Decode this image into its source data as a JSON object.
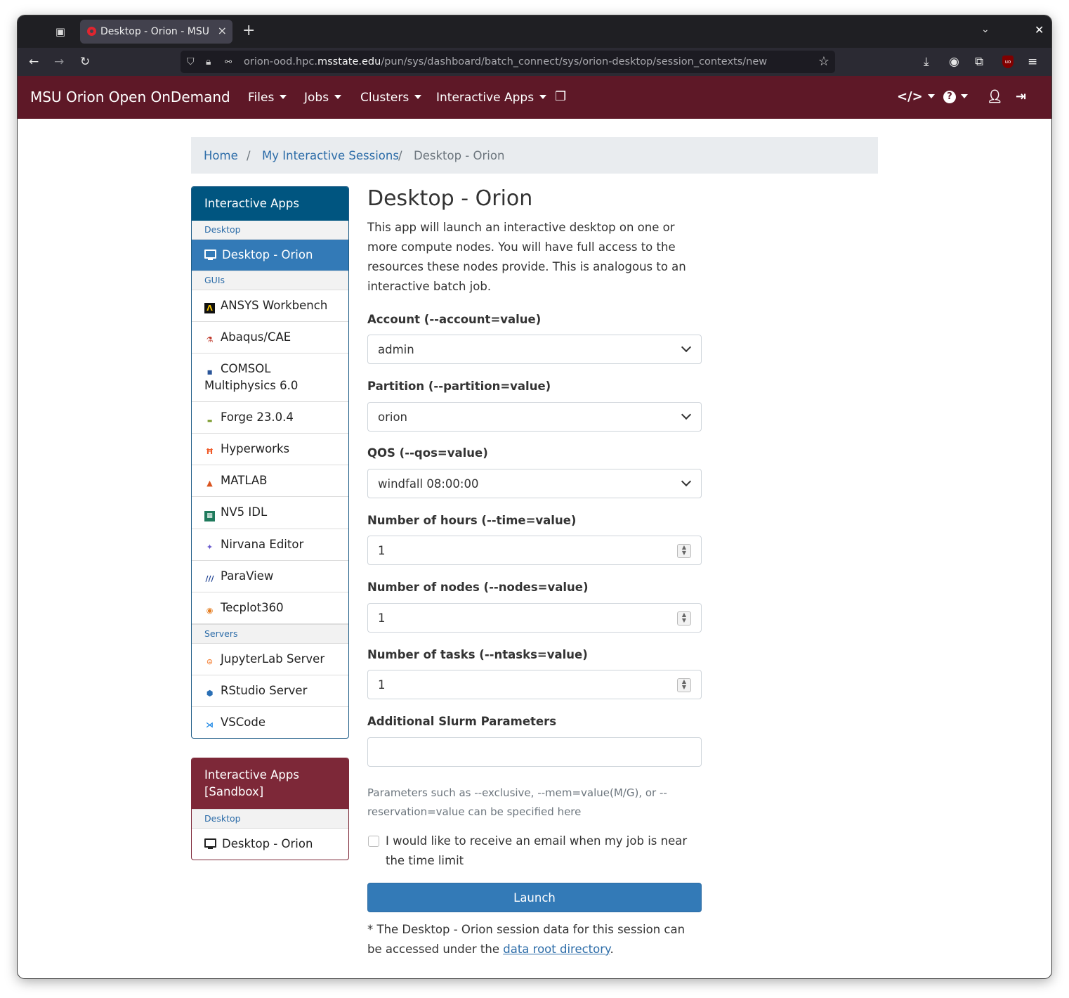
{
  "browser": {
    "tab_title": "Desktop - Orion - MSU Orion Open OnDemand",
    "tab_close": "×",
    "new_tab": "+",
    "url_prefix": "orion-ood.hpc.",
    "url_host": "msstate.edu",
    "url_path": "/pun/sys/dashboard/batch_connect/sys/orion-desktop/session_contexts/new"
  },
  "appnav": {
    "brand": "MSU Orion Open OnDemand",
    "menus": [
      "Files",
      "Jobs",
      "Clusters",
      "Interactive Apps"
    ]
  },
  "breadcrumb": {
    "home": "Home",
    "sep": "/",
    "sessions": "My Interactive Sessions",
    "current": "Desktop - Orion"
  },
  "sidebar": {
    "title": "Interactive Apps",
    "cat_desktop": "Desktop",
    "desktop_orion": "Desktop - Orion",
    "cat_guis": "GUIs",
    "guis": [
      "ANSYS Workbench",
      "Abaqus/CAE",
      "COMSOL Multiphysics 6.0",
      "Forge 23.0.4",
      "Hyperworks",
      "MATLAB",
      "NV5 IDL",
      "Nirvana Editor",
      "ParaView",
      "Tecplot360"
    ],
    "cat_servers": "Servers",
    "servers": [
      "JupyterLab Server",
      "RStudio Server",
      "VSCode"
    ]
  },
  "sandbox": {
    "title": "Interactive Apps [Sandbox]",
    "cat_desktop": "Desktop",
    "desktop_orion": "Desktop - Orion"
  },
  "form": {
    "title": "Desktop - Orion",
    "description": "This app will launch an interactive desktop on one or more compute nodes. You will have full access to the resources these nodes provide. This is analogous to an interactive batch job.",
    "account_label": "Account (--account=value)",
    "account_value": "admin",
    "partition_label": "Partition (--partition=value)",
    "partition_value": "orion",
    "qos_label": "QOS (--qos=value)",
    "qos_value": "windfall 08:00:00",
    "hours_label": "Number of hours (--time=value)",
    "hours_value": "1",
    "nodes_label": "Number of nodes (--nodes=value)",
    "nodes_value": "1",
    "tasks_label": "Number of tasks (--ntasks=value)",
    "tasks_value": "1",
    "slurm_label": "Additional Slurm Parameters",
    "slurm_value": "",
    "slurm_help": "Parameters such as --exclusive, --mem=value(M/G), or --reservation=value can be specified here",
    "email_label": "I would like to receive an email when my job is near the time limit",
    "launch_label": "Launch",
    "footnote_pre": "* The Desktop - Orion session data for this session can be accessed under the ",
    "footnote_link": "data root directory",
    "footnote_post": "."
  }
}
